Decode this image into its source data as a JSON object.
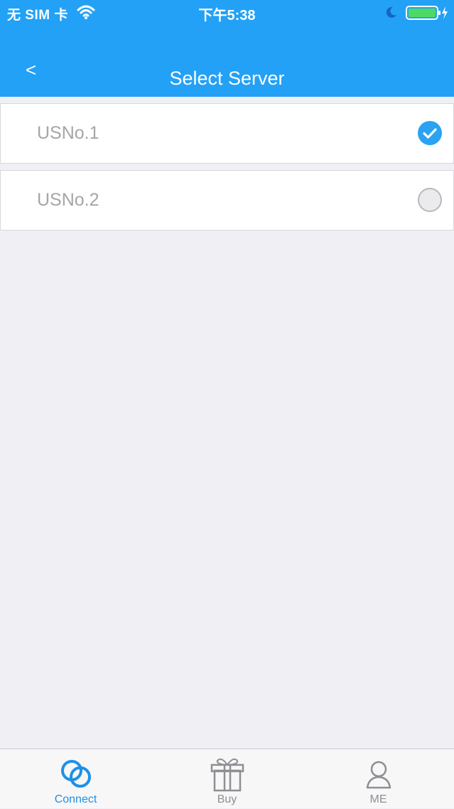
{
  "status_bar": {
    "carrier": "无 SIM 卡",
    "time": "下午5:38"
  },
  "nav": {
    "back_label": "<",
    "title": "Select Server"
  },
  "servers": [
    {
      "name": "USNo.1",
      "selected": true
    },
    {
      "name": "USNo.2",
      "selected": false
    }
  ],
  "tab_bar": {
    "tabs": [
      {
        "label": "Connect",
        "icon": "link-icon",
        "active": true
      },
      {
        "label": "Buy",
        "icon": "gift-icon",
        "active": false
      },
      {
        "label": "ME",
        "icon": "person-icon",
        "active": false
      }
    ]
  },
  "colors": {
    "accent": "#22a1f6",
    "active_tab": "#1e90e8",
    "inactive": "#8e8e93",
    "battery": "#4cd964"
  }
}
